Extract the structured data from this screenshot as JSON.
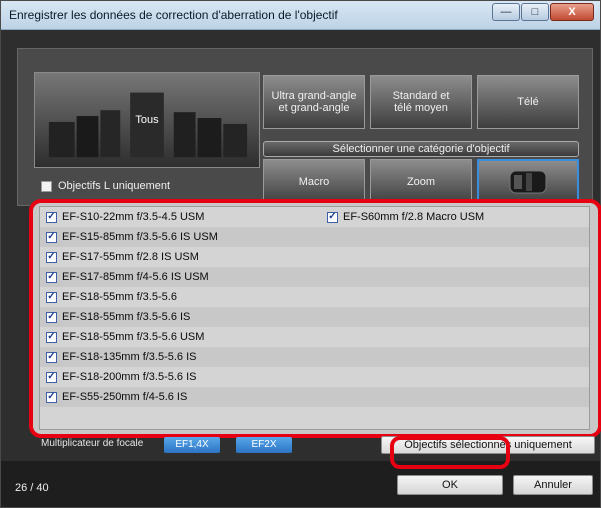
{
  "window": {
    "title": "Enregistrer les données de correction d'aberration de l'objectif",
    "minimize_icon": "minimize-icon",
    "maximize_icon": "maximize-icon",
    "close_label": "X"
  },
  "categories": {
    "all": "Tous",
    "ultra_wide": "Ultra grand-angle\net grand-angle",
    "standard": "Standard et\ntélé moyen",
    "tele": "Télé",
    "select_label": "Sélectionner une catégorie d'objectif",
    "macro": "Macro",
    "zoom": "Zoom",
    "l_only": "Objectifs L uniquement"
  },
  "lenses": {
    "col1": [
      "EF-S10-22mm f/3.5-4.5 USM",
      "EF-S15-85mm f/3.5-5.6 IS USM",
      "EF-S17-55mm f/2.8 IS USM",
      "EF-S17-85mm f/4-5.6 IS USM",
      "EF-S18-55mm f/3.5-5.6",
      "EF-S18-55mm f/3.5-5.6 IS",
      "EF-S18-55mm f/3.5-5.6 USM",
      "EF-S18-135mm f/3.5-5.6 IS",
      "EF-S18-200mm f/3.5-5.6 IS",
      "EF-S55-250mm f/4-5.6 IS"
    ],
    "col2": [
      "EF-S60mm f/2.8 Macro USM"
    ]
  },
  "footer": {
    "multiplier_label": "Multiplicateur de focale",
    "ef14x": "EF1,4X",
    "ef2x": "EF2X",
    "selected_only": "Objectifs sélectionnés uniquement",
    "count": "26 / 40",
    "ok": "OK",
    "cancel": "Annuler"
  }
}
